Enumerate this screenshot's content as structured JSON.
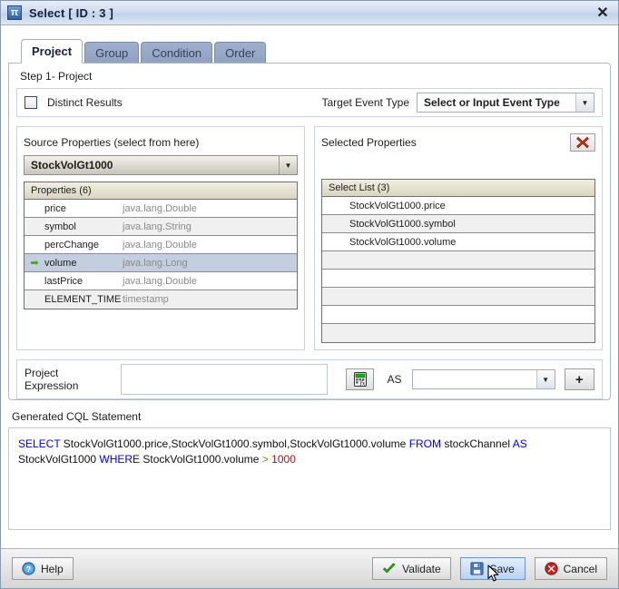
{
  "window": {
    "title": "Select [ ID : 3 ]",
    "icon": "pi-icon",
    "close_label": "✕"
  },
  "tabs": [
    {
      "label": "Project",
      "active": true
    },
    {
      "label": "Group",
      "active": false
    },
    {
      "label": "Condition",
      "active": false
    },
    {
      "label": "Order",
      "active": false
    }
  ],
  "step": {
    "label": "Step 1- Project"
  },
  "options": {
    "distinct_label": "Distinct Results",
    "distinct_checked": false,
    "target_event_type_label": "Target Event Type",
    "target_event_type_value": "Select or Input Event Type",
    "dropdown_arrow": "▼"
  },
  "source_panel": {
    "title": "Source Properties (select from here)",
    "stream_value": "StockVolGt1000",
    "grid_header": "Properties (6)",
    "rows": [
      {
        "marker": "",
        "name": "price",
        "type": "java.lang.Double",
        "selected": false
      },
      {
        "marker": "",
        "name": "symbol",
        "type": "java.lang.String",
        "selected": false
      },
      {
        "marker": "",
        "name": "percChange",
        "type": "java.lang.Double",
        "selected": false
      },
      {
        "marker": "➡",
        "name": "volume",
        "type": "java.lang.Long",
        "selected": true
      },
      {
        "marker": "",
        "name": "lastPrice",
        "type": "java.lang.Double",
        "selected": false
      },
      {
        "marker": "",
        "name": "ELEMENT_TIME",
        "type": "timestamp",
        "selected": false
      }
    ]
  },
  "selected_panel": {
    "title": "Selected Properties",
    "delete_icon": "red-x-icon",
    "grid_header": "Select List (3)",
    "rows": [
      "StockVolGt1000.price",
      "StockVolGt1000.symbol",
      "StockVolGt1000.volume",
      "",
      "",
      "",
      "",
      ""
    ]
  },
  "expression": {
    "label": "Project Expression",
    "value": "",
    "fx_icon": "calculator-fx-icon",
    "as_label": "AS",
    "as_value": "",
    "add_label": "+"
  },
  "cql": {
    "label": "Generated CQL Statement",
    "tokens": [
      {
        "t": "SELECT",
        "c": "kw"
      },
      {
        "t": " StockVolGt1000.price,StockVolGt1000.symbol,StockVolGt1000.volume ",
        "c": "id"
      },
      {
        "t": "FROM",
        "c": "kw"
      },
      {
        "t": " stockChannel ",
        "c": "id"
      },
      {
        "t": "AS",
        "c": "kw"
      },
      {
        "t": " StockVolGt1000 ",
        "c": "id"
      },
      {
        "t": "WHERE",
        "c": "kw"
      },
      {
        "t": " StockVolGt1000.volume ",
        "c": "id"
      },
      {
        "t": ">",
        "c": "op"
      },
      {
        "t": " ",
        "c": "id"
      },
      {
        "t": "1000",
        "c": "num"
      }
    ]
  },
  "footer": {
    "help_label": "Help",
    "validate_label": "Validate",
    "save_label": "Save",
    "cancel_label": "Cancel"
  },
  "colors": {
    "accent": "#0000e0",
    "keyword": "#0000e0",
    "number": "#9a1414",
    "operator": "#7b7b00",
    "selection": "#c3cedf",
    "danger": "#cc2200",
    "success": "#3f9a2a"
  }
}
